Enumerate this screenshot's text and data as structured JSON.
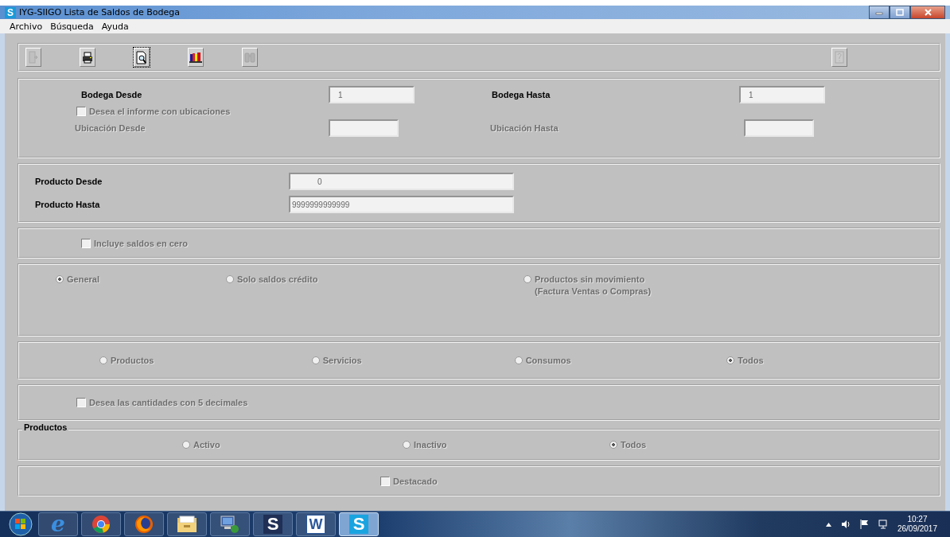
{
  "window": {
    "icon_letter": "S",
    "title": "IYG-SIIGO Lista de Saldos de Bodega"
  },
  "menu": [
    "Archivo",
    "Búsqueda",
    "Ayuda"
  ],
  "toolbar": [
    {
      "kind": "exit",
      "disabled": true
    },
    {
      "kind": "print",
      "disabled": false
    },
    {
      "kind": "preview",
      "disabled": false
    },
    {
      "kind": "books",
      "disabled": false
    },
    {
      "kind": "binoculars",
      "disabled": true
    },
    {
      "kind": "help",
      "disabled": true
    }
  ],
  "bodega": {
    "desde": {
      "label": "Bodega Desde",
      "value": "1"
    },
    "hasta": {
      "label": "Bodega Hasta",
      "value": "1"
    },
    "ubicaciones": {
      "label": "Desea el informe con ubicaciones",
      "checked": false,
      "disabled": true
    },
    "ubicacion_desde": {
      "label": "Ubicación Desde",
      "disabled": true
    },
    "ubicacion_hasta": {
      "label": "Ubicación Hasta",
      "disabled": true
    }
  },
  "producto": {
    "desde": {
      "label": "Producto Desde",
      "value": "0"
    },
    "hasta": {
      "label": "Producto Hasta",
      "value": "9999999999999"
    }
  },
  "saldos_cero": {
    "label": "Incluye saldos en cero",
    "checked": false,
    "disabled": true
  },
  "report_type": [
    {
      "label": "General",
      "selected": true,
      "disabled": true
    },
    {
      "label": "Solo saldos  crédito",
      "selected": false,
      "disabled": true
    },
    {
      "label": "Productos sin movimiento",
      "note": "(Factura Ventas o Compras)",
      "selected": false,
      "disabled": true
    }
  ],
  "item_type": [
    {
      "label": "Productos",
      "selected": false,
      "disabled": true
    },
    {
      "label": "Servicios",
      "selected": false,
      "disabled": true
    },
    {
      "label": "Consumos",
      "selected": false,
      "disabled": true
    },
    {
      "label": "Todos",
      "selected": true,
      "disabled": true
    }
  ],
  "decimales": {
    "label": "Desea las cantidades con 5 decimales",
    "checked": false,
    "disabled": true
  },
  "productos_group": {
    "title": "Productos",
    "options": [
      {
        "label": "Activo",
        "selected": false,
        "disabled": true
      },
      {
        "label": "Inactivo",
        "selected": false,
        "disabled": true
      },
      {
        "label": "Todos",
        "selected": true,
        "disabled": true
      }
    ]
  },
  "destacado": {
    "label": "Destacado",
    "checked": false,
    "disabled": true
  },
  "taskbar": {
    "apps": [
      {
        "kind": "start"
      },
      {
        "kind": "ie",
        "label": "e",
        "selected": false
      },
      {
        "kind": "chrome",
        "selected": false
      },
      {
        "kind": "firefox",
        "selected": false
      },
      {
        "kind": "explorer",
        "selected": false
      },
      {
        "kind": "network",
        "selected": false
      },
      {
        "kind": "siigo",
        "label": "S",
        "selected": false
      },
      {
        "kind": "word",
        "label": "W",
        "selected": false
      },
      {
        "kind": "siigo",
        "label": "S",
        "selected": true
      }
    ],
    "time": "10:27",
    "date": "26/09/2017"
  }
}
